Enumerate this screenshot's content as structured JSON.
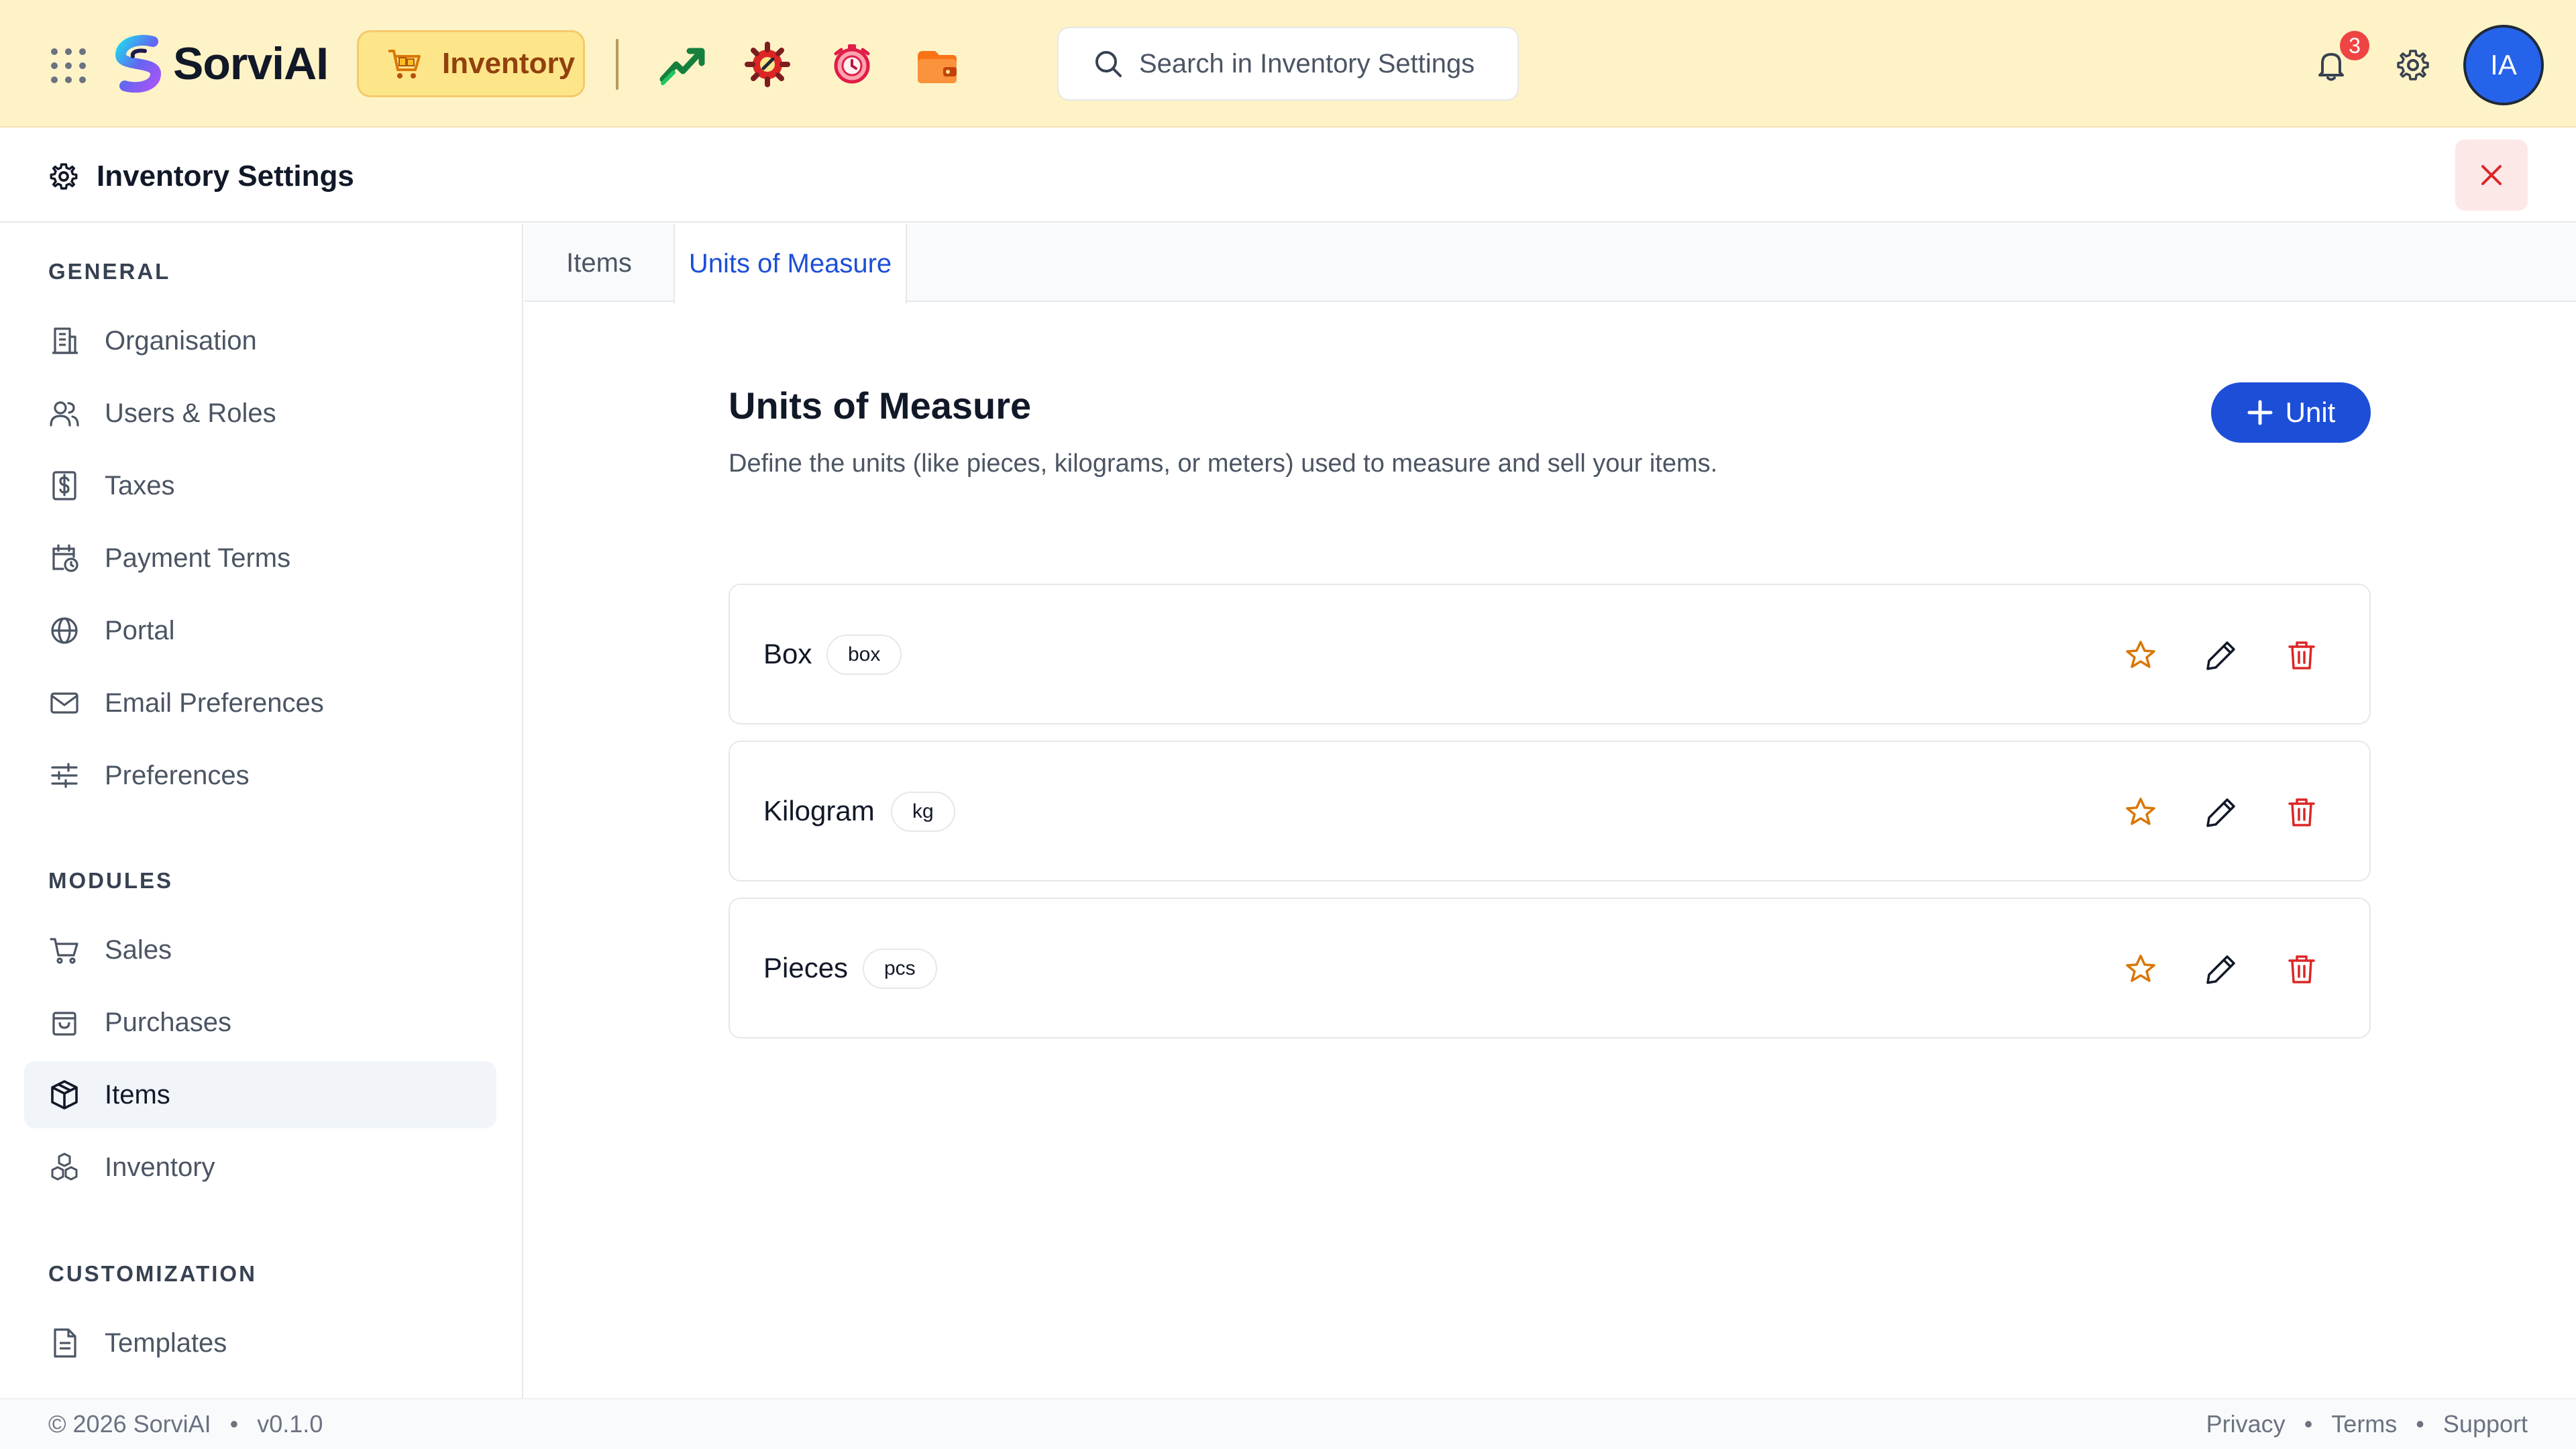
{
  "topbar": {
    "brand": "SorviAI",
    "module": "Inventory",
    "search_placeholder": "Search in Inventory Settings",
    "notification_count": "3",
    "avatar_initials": "IA"
  },
  "settings": {
    "title": "Inventory Settings"
  },
  "sidebar": {
    "general_label": "GENERAL",
    "general": [
      {
        "label": "Organisation",
        "icon": "building-icon"
      },
      {
        "label": "Users & Roles",
        "icon": "users-icon"
      },
      {
        "label": "Taxes",
        "icon": "dollar-receipt-icon"
      },
      {
        "label": "Payment Terms",
        "icon": "calendar-clock-icon"
      },
      {
        "label": "Portal",
        "icon": "globe-icon"
      },
      {
        "label": "Email Preferences",
        "icon": "mail-icon"
      },
      {
        "label": "Preferences",
        "icon": "sliders-icon"
      }
    ],
    "modules_label": "MODULES",
    "modules": [
      {
        "label": "Sales",
        "icon": "cart-icon"
      },
      {
        "label": "Purchases",
        "icon": "bag-icon"
      },
      {
        "label": "Items",
        "icon": "box-icon",
        "active": true
      },
      {
        "label": "Inventory",
        "icon": "boxes-icon"
      }
    ],
    "customization_label": "CUSTOMIZATION",
    "customization": [
      {
        "label": "Templates",
        "icon": "document-icon"
      }
    ]
  },
  "tabs": [
    {
      "label": "Items",
      "active": false
    },
    {
      "label": "Units of Measure",
      "active": true
    }
  ],
  "main": {
    "title": "Units of Measure",
    "description": "Define the units (like pieces, kilograms, or meters) used to measure and sell your items.",
    "add_button": "Unit",
    "units": [
      {
        "name": "Box",
        "abbr": "box"
      },
      {
        "name": "Kilogram",
        "abbr": "kg"
      },
      {
        "name": "Pieces",
        "abbr": "pcs"
      }
    ]
  },
  "footer": {
    "copyright": "© 2026 SorviAI",
    "version": "v0.1.0",
    "links": [
      "Privacy",
      "Terms",
      "Support"
    ]
  },
  "colors": {
    "topbar_bg": "#fef3c7",
    "accent": "#1d4ed8",
    "danger": "#dc2626",
    "star": "#d97706"
  }
}
